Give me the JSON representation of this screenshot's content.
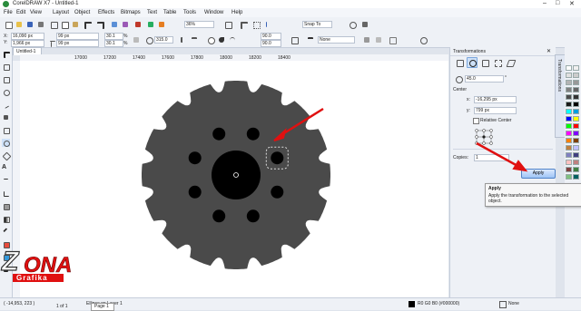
{
  "window": {
    "title": "CorelDRAW X7 - Untitled-1",
    "controls": [
      "–",
      "□",
      "✕"
    ]
  },
  "menu": [
    "File",
    "Edit",
    "View",
    "Layout",
    "Object",
    "Effects",
    "Bitmaps",
    "Text",
    "Table",
    "Tools",
    "Window",
    "Help"
  ],
  "toolbar": {
    "zoom": "36%",
    "snap_to": "Snap To"
  },
  "propbar": {
    "x": "16,090 px",
    "y": "1,966 px",
    "w": "99 px",
    "h": "99 px",
    "sx": "30.1",
    "sy": "30.1",
    "pct": "%",
    "rotation": "315.0",
    "angle1": "90.0",
    "angle2": "90.0",
    "outline": "None"
  },
  "document": {
    "tab": "Untitled-1",
    "ruler_marks": [
      "17000",
      "17200",
      "17400",
      "17600",
      "17800",
      "18000",
      "18200",
      "18400"
    ]
  },
  "docker": {
    "title": "Transformations",
    "angle": "45.0",
    "angle_unit": "°",
    "center_label": "Center",
    "center_x_label": "x:",
    "center_x": "-16,295 px",
    "center_y_label": "y:",
    "center_y": "799 px",
    "relative_center": "Relative Center",
    "copies_label": "Copies:",
    "copies": "1",
    "apply": "Apply",
    "vertical_tab": "Transformations"
  },
  "tooltip": {
    "title": "Apply",
    "text": "Apply the transformation to the selected object."
  },
  "status": {
    "coords": "( -14,953, 223 )",
    "object": "Ellipse on Layer 1",
    "fill": "R0 G0 B0 (#000000)",
    "outline": "None",
    "page": "Page 1",
    "page_count": "1 of 1"
  },
  "logo": {
    "word": "ZONA",
    "sub": "Grafika"
  },
  "colors": {
    "gear": "#4a4a4a",
    "accent": "#e01010",
    "hole": "#000000",
    "apply_border": "#4f82c7"
  },
  "palette": [
    "#ffffff",
    "#f0f0f0",
    "#e0e0e0",
    "#cccccc",
    "#b3b3b3",
    "#999999",
    "#808080",
    "#666666",
    "#4d4d4d",
    "#333333",
    "#1a1a1a",
    "#000000",
    "#00ffff",
    "#00a0e0",
    "#0000ff",
    "#ffff00",
    "#00ff00",
    "#ff0000",
    "#ff00ff",
    "#8000ff",
    "#ff8000",
    "#804000",
    "#c08040",
    "#c0c0ff",
    "#8080c0",
    "#404080",
    "#ffc0c0",
    "#c08080",
    "#804040",
    "#408040",
    "#80c080",
    "#006060"
  ]
}
